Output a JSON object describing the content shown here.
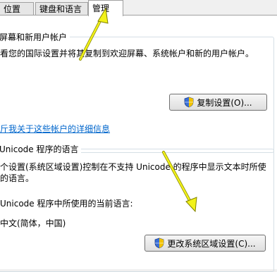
{
  "tabs": [
    {
      "label": "位置"
    },
    {
      "label": "键盘和语言"
    },
    {
      "label": "管理"
    }
  ],
  "welcome": {
    "title": "屏幕和新用户帐户",
    "description": "看您的国际设置并将其复制到欢迎屏幕、系统帐户和新的用户帐户。",
    "copy_button": "复制设置(O)...",
    "link": "斤我关于这些帐户的详细信息"
  },
  "unicode": {
    "title": "Unicode 程序的语言",
    "line1": "个设置(系统区域设置)控制在不支持 Unicode 的程序中显示文本时所使",
    "line2": "的语言。",
    "current_label": "Unicode 程序中所使用的当前语言:",
    "current_value": "中文(简体，中国)",
    "change_button": "更改系统区域设置(C)..."
  },
  "colors": {
    "arrow": "#f2f21a",
    "link": "#0066cc"
  }
}
